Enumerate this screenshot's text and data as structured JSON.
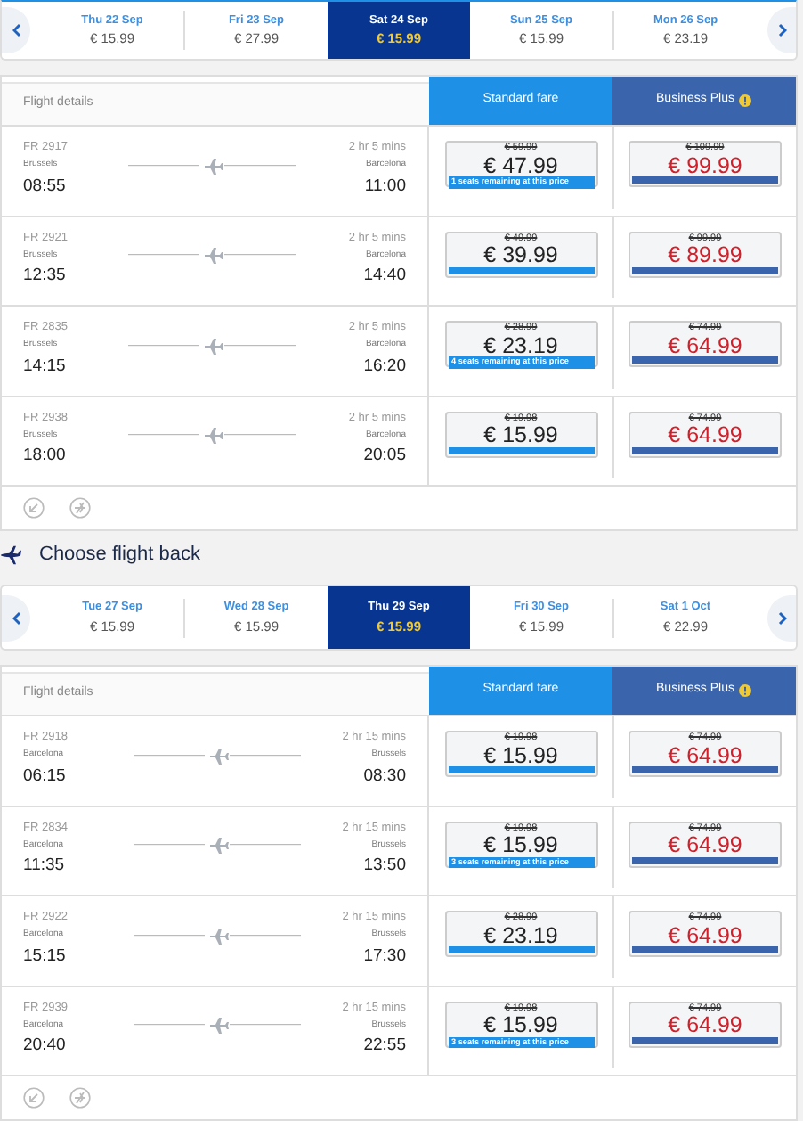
{
  "outbound": {
    "dates": [
      {
        "day": "Thu 22 Sep",
        "price": "€ 15.99",
        "selected": false
      },
      {
        "day": "Fri 23 Sep",
        "price": "€ 27.99",
        "selected": false
      },
      {
        "day": "Sat 24 Sep",
        "price": "€ 15.99",
        "selected": true
      },
      {
        "day": "Sun 25 Sep",
        "price": "€ 15.99",
        "selected": false
      },
      {
        "day": "Mon 26 Sep",
        "price": "€ 23.19",
        "selected": false
      }
    ],
    "table": {
      "header": "Flight details",
      "fares": [
        "Standard fare",
        "Business Plus"
      ],
      "flights": [
        {
          "number": "FR 2917",
          "duration": "2 hr 5 mins",
          "from": "Brussels",
          "to": "Barcelona",
          "depart": "08:55",
          "arrive": "11:00",
          "standard": {
            "old": "€ 59.99",
            "price": "€ 47.99",
            "note": "1 seats remaining at this price"
          },
          "business": {
            "old": "€ 109.99",
            "price": "€ 99.99"
          }
        },
        {
          "number": "FR 2921",
          "duration": "2 hr 5 mins",
          "from": "Brussels",
          "to": "Barcelona",
          "depart": "12:35",
          "arrive": "14:40",
          "standard": {
            "old": "€ 49.99",
            "price": "€ 39.99"
          },
          "business": {
            "old": "€ 99.99",
            "price": "€ 89.99"
          }
        },
        {
          "number": "FR 2835",
          "duration": "2 hr 5 mins",
          "from": "Brussels",
          "to": "Barcelona",
          "depart": "14:15",
          "arrive": "16:20",
          "standard": {
            "old": "€ 28.99",
            "price": "€ 23.19",
            "note": "4 seats remaining at this price"
          },
          "business": {
            "old": "€ 74.99",
            "price": "€ 64.99"
          }
        },
        {
          "number": "FR 2938",
          "duration": "2 hr 5 mins",
          "from": "Brussels",
          "to": "Barcelona",
          "depart": "18:00",
          "arrive": "20:05",
          "standard": {
            "old": "€ 19.98",
            "price": "€ 15.99"
          },
          "business": {
            "old": "€ 74.99",
            "price": "€ 64.99"
          }
        }
      ]
    }
  },
  "return_heading": "Choose flight back",
  "return": {
    "dates": [
      {
        "day": "Tue 27 Sep",
        "price": "€ 15.99",
        "selected": false
      },
      {
        "day": "Wed 28 Sep",
        "price": "€ 15.99",
        "selected": false
      },
      {
        "day": "Thu 29 Sep",
        "price": "€ 15.99",
        "selected": true
      },
      {
        "day": "Fri 30 Sep",
        "price": "€ 15.99",
        "selected": false
      },
      {
        "day": "Sat 1 Oct",
        "price": "€ 22.99",
        "selected": false
      }
    ],
    "table": {
      "header": "Flight details",
      "fares": [
        "Standard fare",
        "Business Plus"
      ],
      "flights": [
        {
          "number": "FR 2918",
          "duration": "2 hr 15 mins",
          "from": "Barcelona",
          "to": "Brussels",
          "depart": "06:15",
          "arrive": "08:30",
          "standard": {
            "old": "€ 19.98",
            "price": "€ 15.99"
          },
          "business": {
            "old": "€ 74.99",
            "price": "€ 64.99"
          }
        },
        {
          "number": "FR 2834",
          "duration": "2 hr 15 mins",
          "from": "Barcelona",
          "to": "Brussels",
          "depart": "11:35",
          "arrive": "13:50",
          "standard": {
            "old": "€ 19.98",
            "price": "€ 15.99",
            "note": "3 seats remaining at this price"
          },
          "business": {
            "old": "€ 74.99",
            "price": "€ 64.99"
          }
        },
        {
          "number": "FR 2922",
          "duration": "2 hr 15 mins",
          "from": "Barcelona",
          "to": "Brussels",
          "depart": "15:15",
          "arrive": "17:30",
          "standard": {
            "old": "€ 28.99",
            "price": "€ 23.19"
          },
          "business": {
            "old": "€ 74.99",
            "price": "€ 64.99"
          }
        },
        {
          "number": "FR 2939",
          "duration": "2 hr 15 mins",
          "from": "Barcelona",
          "to": "Brussels",
          "depart": "20:40",
          "arrive": "22:55",
          "standard": {
            "old": "€ 19.98",
            "price": "€ 15.99",
            "note": "3 seats remaining at this price"
          },
          "business": {
            "old": "€ 74.99",
            "price": "€ 64.99"
          }
        }
      ]
    }
  }
}
